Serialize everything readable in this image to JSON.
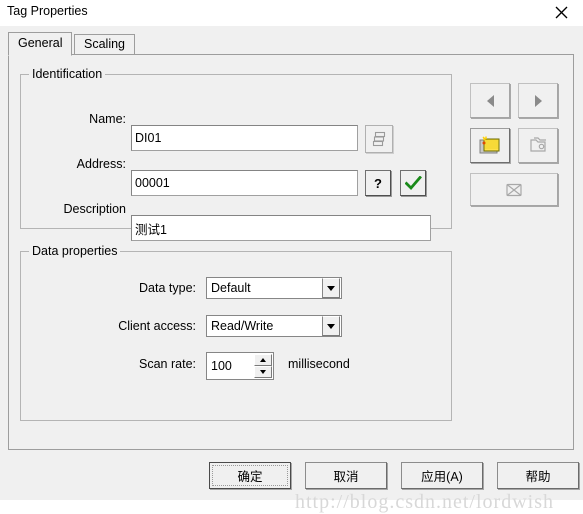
{
  "window": {
    "title": "Tag Properties",
    "close_icon": "close-icon"
  },
  "tabs": [
    {
      "label": "General",
      "active": true
    },
    {
      "label": "Scaling",
      "active": false
    }
  ],
  "identification": {
    "group_title": "Identification",
    "name": {
      "label": "Name:",
      "value": "DI01",
      "placeholder": ""
    },
    "name_browse_button": {
      "icon": "stacked-tags-icon",
      "enabled": false
    },
    "address": {
      "label": "Address:",
      "value": "00001",
      "placeholder": ""
    },
    "address_help_button": {
      "label": "?",
      "icon": "question-mark-icon"
    },
    "address_validate_button": {
      "icon": "green-check-icon",
      "color": "#1a8a1a"
    },
    "description": {
      "label": "Description",
      "value": "测试1",
      "placeholder": ""
    }
  },
  "data_properties": {
    "group_title": "Data properties",
    "data_type": {
      "label": "Data type:",
      "value": "Default",
      "options": [
        "Default"
      ]
    },
    "client_access": {
      "label": "Client access:",
      "value": "Read/Write",
      "options": [
        "Read/Write"
      ]
    },
    "scan_rate": {
      "label": "Scan rate:",
      "value": "100",
      "units": "milliseconds"
    }
  },
  "side_buttons": {
    "previous": {
      "icon": "triangle-left-icon",
      "enabled": false
    },
    "next": {
      "icon": "triangle-right-icon",
      "enabled": false
    },
    "new_tag": {
      "icon": "new-tag-folder-icon",
      "enabled": true
    },
    "duplicate": {
      "icon": "copy-tags-icon",
      "enabled": false
    },
    "delete": {
      "icon": "delete-tag-icon",
      "enabled": false
    }
  },
  "footer": {
    "ok": "确定",
    "cancel": "取消",
    "apply": "应用(A)",
    "help": "帮助"
  },
  "watermark": {
    "text": "http://blog.csdn.net/lordwish"
  },
  "colors": {
    "dialog_bg": "#f0f0f0",
    "field_bg": "#ffffff",
    "border": "#9d9d9d",
    "group_border": "#b4b4b4",
    "check_green": "#1a8a1a",
    "folder_yellow": "#ffe24a"
  }
}
